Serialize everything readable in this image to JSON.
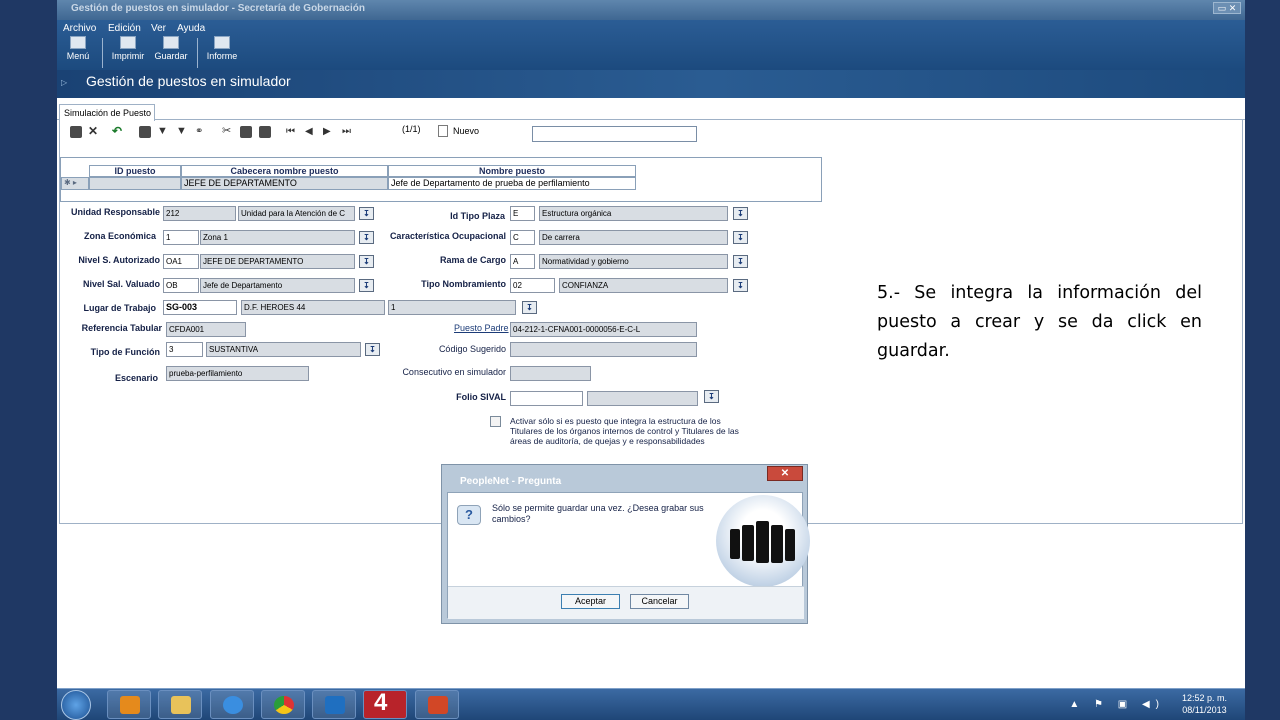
{
  "window": {
    "title": "Gestión de puestos en simulador - Secretaría de Gobernación",
    "controls": "▭ ✕"
  },
  "menu": [
    "Archivo",
    "Edición",
    "Ver",
    "Ayuda"
  ],
  "toolbar": {
    "menu_label": "Menú",
    "print_label": "Imprimir",
    "save_label": "Guardar",
    "report_label": "Informe"
  },
  "header": {
    "title": "Gestión de puestos en simulador"
  },
  "tab": {
    "label": "Simulación de Puesto"
  },
  "nav": {
    "counter": "(1/1)",
    "new_label": "Nuevo"
  },
  "grid": {
    "columns": [
      "ID puesto",
      "Cabecera nombre puesto",
      "Nombre puesto"
    ],
    "row_marker": "✱ ▸",
    "row": {
      "id": "",
      "cabecera": "JEFE DE DEPARTAMENTO",
      "nombre": "Jefe de Departamento de prueba de perfilamiento"
    }
  },
  "form": {
    "unidad_responsable": {
      "label": "Unidad Responsable",
      "code": "212",
      "desc": "Unidad para la Atención de C"
    },
    "zona_economica": {
      "label": "Zona Económica",
      "code": "1",
      "desc": "Zona 1"
    },
    "nivel_autorizado": {
      "label": "Nivel S. Autorizado",
      "code": "OA1",
      "desc": "JEFE DE DEPARTAMENTO"
    },
    "nivel_valuado": {
      "label": "Nivel Sal. Valuado",
      "code": "OB",
      "desc": "Jefe de Departamento"
    },
    "lugar_trabajo": {
      "label": "Lugar de Trabajo",
      "code": "SG-003",
      "desc": "D.F. HEROES 44",
      "extra": "1"
    },
    "referencia_tabular": {
      "label": "Referencia Tabular",
      "value": "CFDA001"
    },
    "tipo_funcion": {
      "label": "Tipo de Función",
      "code": "3",
      "desc": "SUSTANTIVA"
    },
    "escenario": {
      "label": "Escenario",
      "value": "prueba-perfilamiento"
    },
    "id_tipo_plaza": {
      "label": "Id Tipo Plaza",
      "code": "E",
      "desc": "Estructura orgánica"
    },
    "caracteristica": {
      "label": "Característica Ocupacional",
      "code": "C",
      "desc": "De carrera"
    },
    "rama_cargo": {
      "label": "Rama de Cargo",
      "code": "A",
      "desc": "Normatividad y gobierno"
    },
    "tipo_nombramiento": {
      "label": "Tipo Nombramiento",
      "code": "02",
      "desc": "CONFIANZA"
    },
    "puesto_padre": {
      "label": "Puesto Padre",
      "value": "04-212-1-CFNA001-0000056-E-C-L"
    },
    "codigo_sugerido": {
      "label": "Código Sugerido",
      "value": ""
    },
    "consecutivo": {
      "label": "Consecutivo en simulador",
      "value": ""
    },
    "folio_sival": {
      "label": "Folio SIVAL",
      "value": ""
    },
    "checkbox_text": "Activar sólo si es puesto que integra la estructura de los Titulares de los órganos internos de control y Titulares de las áreas de auditoría, de quejas y e responsabilidades"
  },
  "dialog": {
    "title": "PeopleNet - Pregunta",
    "message": "Sólo se permite guardar una vez. ¿Desea grabar sus cambios?",
    "accept": "Aceptar",
    "cancel": "Cancelar",
    "close": "✕",
    "question_glyph": "?"
  },
  "taskbar": {
    "time": "12:52 p. m.",
    "date": "08/11/2013",
    "tray": "▲ ⚑ ▣ ◀)",
    "big_number": "4"
  },
  "caption": "5.- Se integra la información del puesto a crear y se da click en guardar.",
  "colors": {
    "desktop": "#1f3864",
    "header": "#2a5c92",
    "dialog_frame": "#b9c9d9"
  },
  "icons": [
    "new-icon",
    "delete-icon",
    "undo-icon",
    "filter-icon",
    "find-icon",
    "cut-icon",
    "copy-icon",
    "paste-icon",
    "first-icon",
    "prev-icon",
    "next-icon",
    "last-icon"
  ]
}
